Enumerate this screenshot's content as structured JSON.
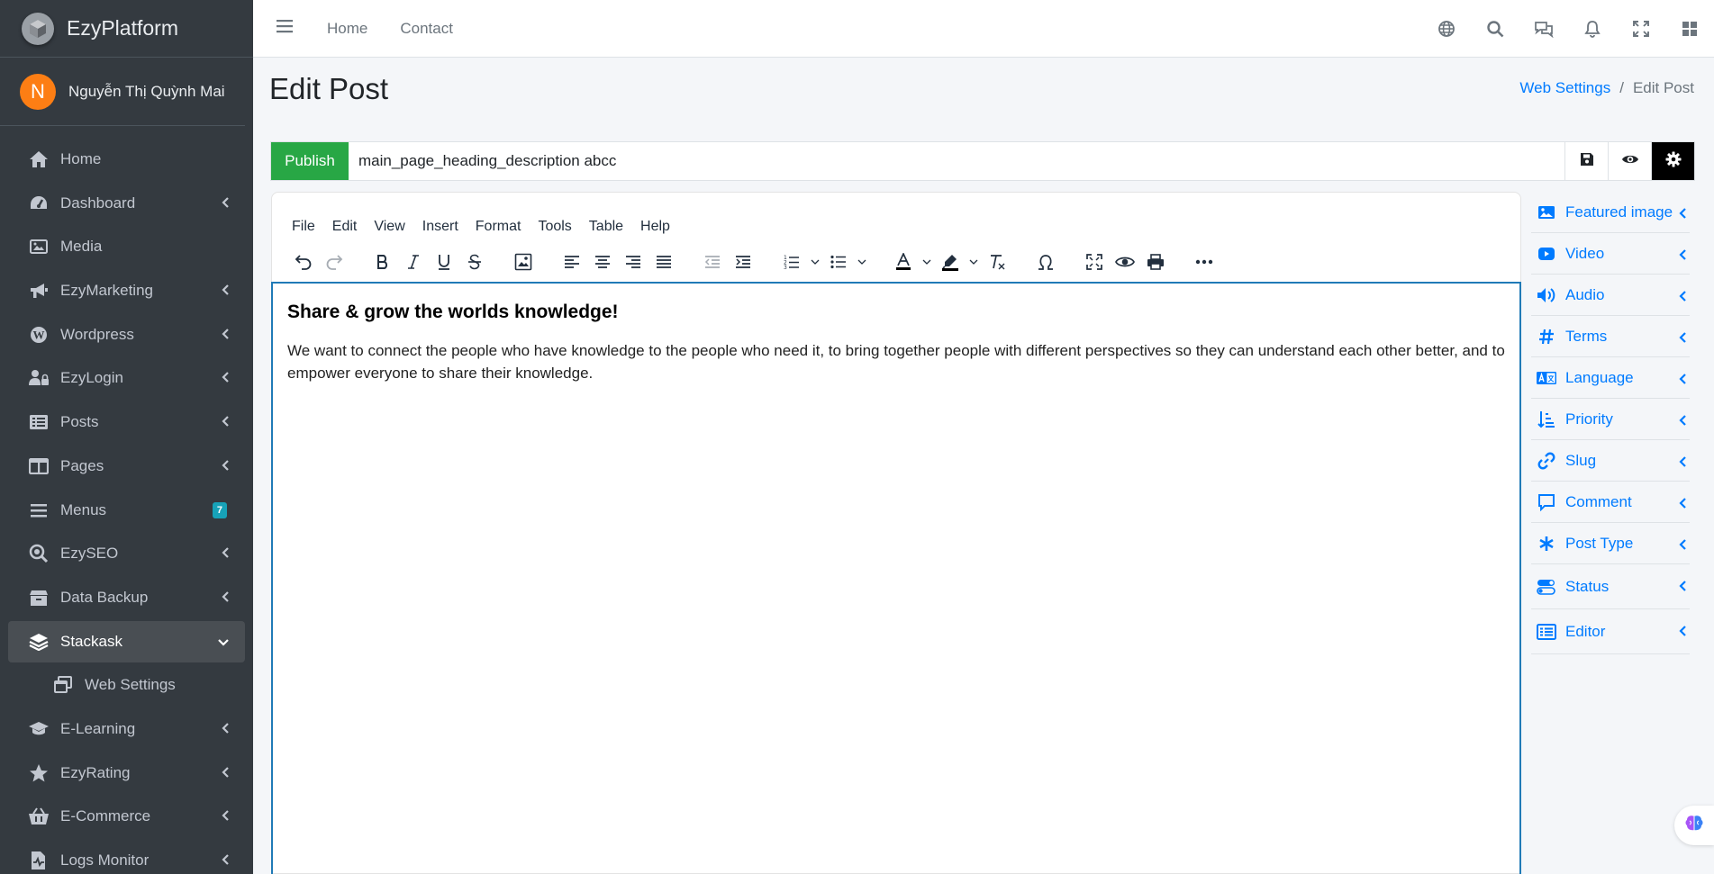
{
  "brand": {
    "name": "EzyPlatform"
  },
  "user": {
    "initial": "N",
    "name": "Nguyễn Thị Quỳnh Mai"
  },
  "sidebar": {
    "items": [
      {
        "label": "Home"
      },
      {
        "label": "Dashboard"
      },
      {
        "label": "Media"
      },
      {
        "label": "EzyMarketing"
      },
      {
        "label": "Wordpress"
      },
      {
        "label": "EzyLogin"
      },
      {
        "label": "Posts"
      },
      {
        "label": "Pages"
      },
      {
        "label": "Menus",
        "badge": "7"
      },
      {
        "label": "EzySEO"
      },
      {
        "label": "Data Backup"
      },
      {
        "label": "Stackask"
      },
      {
        "label": "Web Settings"
      },
      {
        "label": "E-Learning"
      },
      {
        "label": "EzyRating"
      },
      {
        "label": "E-Commerce"
      },
      {
        "label": "Logs Monitor"
      }
    ]
  },
  "topbar": {
    "links": [
      "Home",
      "Contact"
    ]
  },
  "page": {
    "title": "Edit Post",
    "breadcrumb": {
      "parent": "Web Settings",
      "current": "Edit Post"
    }
  },
  "post": {
    "publish_label": "Publish",
    "title_value": "main_page_heading_description abcc"
  },
  "editor": {
    "menus": [
      "File",
      "Edit",
      "View",
      "Insert",
      "Format",
      "Tools",
      "Table",
      "Help"
    ],
    "heading": "Share & grow the worlds knowledge!",
    "paragraph": "We want to connect the people who have knowledge to the people who need it, to bring together people with different perspectives so they can understand each other better, and to empower everyone to share their knowledge."
  },
  "right_panel": {
    "items": [
      "Featured image",
      "Video",
      "Audio",
      "Terms",
      "Language",
      "Priority",
      "Slug",
      "Comment",
      "Post Type",
      "Status",
      "Editor"
    ]
  },
  "colors": {
    "sidebar_bg": "#343a40",
    "publish": "#28a745",
    "link": "#007bff",
    "editor_border": "#207ab7"
  }
}
